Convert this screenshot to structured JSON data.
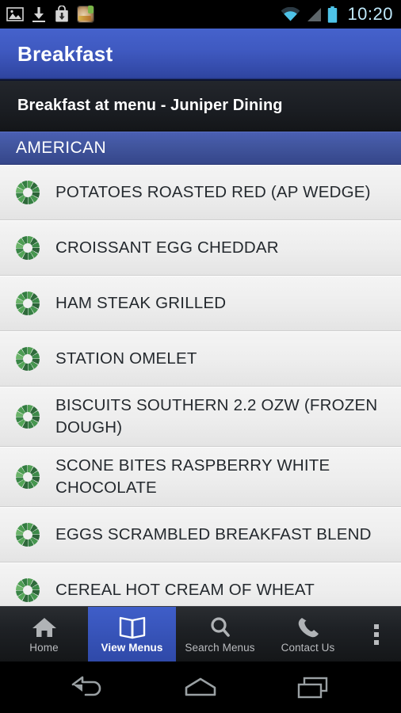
{
  "status_bar": {
    "icons": [
      "image-icon",
      "download-icon",
      "play-store-download-icon",
      "app-icon"
    ],
    "wifi_icon": "wifi-icon",
    "signal_icon": "cell-signal-icon",
    "battery_icon": "battery-icon",
    "time": "10:20",
    "time_color": "#bfe9fb"
  },
  "action_bar": {
    "title": "Breakfast",
    "background_color": "#3f59c0"
  },
  "subheader": {
    "text": "Breakfast at menu - Juniper Dining",
    "background_color": "#1a1d22"
  },
  "section": {
    "label": "AMERICAN",
    "background_color": "#42569f"
  },
  "menu_items": [
    {
      "icon": "green-donut-icon",
      "label": "POTATOES  ROASTED  RED (AP WEDGE)"
    },
    {
      "icon": "green-donut-icon",
      "label": "CROISSANT  EGG  CHEDDAR"
    },
    {
      "icon": "green-donut-icon",
      "label": "HAM STEAK  GRILLED"
    },
    {
      "icon": "green-donut-icon",
      "label": "STATION  OMELET"
    },
    {
      "icon": "green-donut-icon",
      "label": "BISCUITS  SOUTHERN  2.2 OZW (FROZEN DOUGH)"
    },
    {
      "icon": "green-donut-icon",
      "label": "SCONE BITES  RASPBERRY  WHITE CHOCOLATE"
    },
    {
      "icon": "green-donut-icon",
      "label": "EGGS  SCRAMBLED  BREAKFAST BLEND"
    },
    {
      "icon": "green-donut-icon",
      "label": "CEREAL  HOT  CREAM OF WHEAT"
    }
  ],
  "tab_bar": {
    "active_color": "#2f49a8",
    "tabs": [
      {
        "label": "Home",
        "icon": "home-icon",
        "active": false
      },
      {
        "label": "View Menus",
        "icon": "book-icon",
        "active": true
      },
      {
        "label": "Search Menus",
        "icon": "search-icon",
        "active": false
      },
      {
        "label": "Contact Us",
        "icon": "phone-icon",
        "active": false
      }
    ],
    "overflow_icon": "overflow-menu-icon"
  },
  "nav_bar": {
    "back_icon": "back-icon",
    "home_icon": "home-nav-icon",
    "recents_icon": "recent-apps-icon"
  }
}
